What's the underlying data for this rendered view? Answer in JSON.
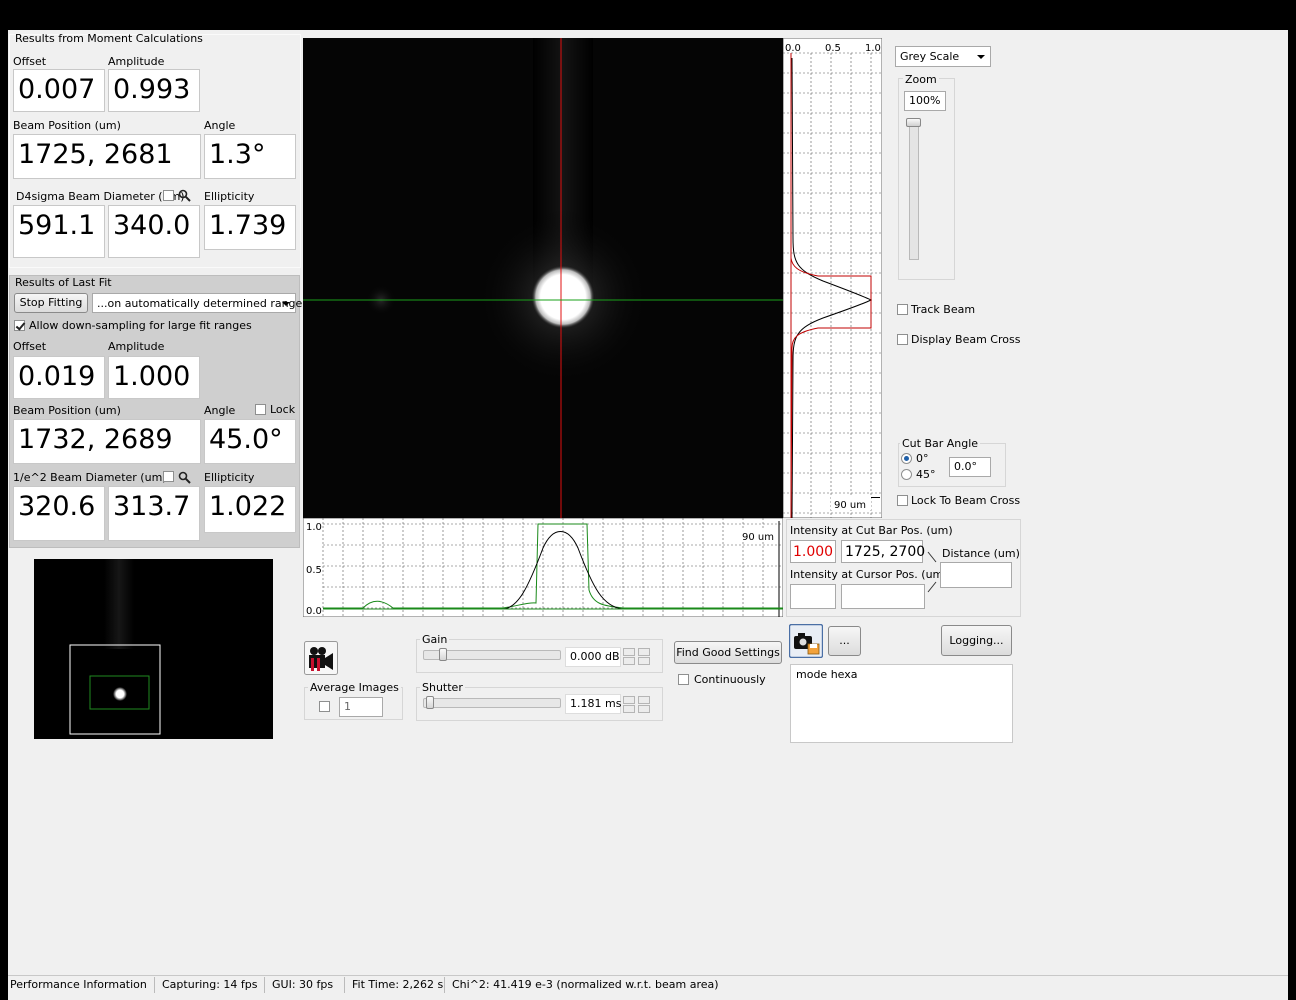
{
  "moment": {
    "title": "Results from Moment Calculations",
    "offset_label": "Offset",
    "offset": "0.007",
    "amplitude_label": "Amplitude",
    "amplitude": "0.993",
    "beam_pos_label": "Beam Position (um)",
    "beam_pos": "1725, 2681",
    "angle_label": "Angle",
    "angle": "1.3°",
    "diameter_label": "D4sigma Beam Diameter (um)",
    "diam_x": "591.1",
    "diam_y": "340.0",
    "ellipticity_label": "Ellipticity",
    "ellipticity": "1.739"
  },
  "fit": {
    "title": "Results of Last Fit",
    "stop_label": "Stop Fitting",
    "range_value": "...on automatically determined range",
    "downsample_label": "Allow down-sampling for large fit ranges",
    "offset_label": "Offset",
    "offset": "0.019",
    "amplitude_label": "Amplitude",
    "amplitude": "1.000",
    "beam_pos_label": "Beam Position (um)",
    "beam_pos": "1732, 2689",
    "angle_label": "Angle",
    "lock_label": "Lock",
    "angle": "45.0°",
    "diameter_label": "1/e^2 Beam Diameter (um)",
    "diam_x": "320.6",
    "diam_y": "313.7",
    "ellipticity_label": "Ellipticity",
    "ellipticity": "1.022"
  },
  "vprofile": {
    "tick_0": "0.0",
    "tick_05": "0.5",
    "tick_1": "1.0",
    "scale": "90 um"
  },
  "hprofile": {
    "tick_1": "1.0",
    "tick_05": "0.5",
    "tick_0": "0.0",
    "scale": "90 um"
  },
  "display": {
    "colormap": "Grey Scale",
    "zoom_label": "Zoom",
    "zoom_value": "100%",
    "zoom_level": 1.0,
    "track_beam": "Track Beam",
    "display_cross": "Display Beam Cross",
    "cut_angle_label": "Cut Bar Angle",
    "angle_0": "0°",
    "angle_45": "45°",
    "angle_value": "0.0°",
    "lock_cross": "Lock To Beam Cross"
  },
  "intensity": {
    "cut_label": "Intensity at Cut Bar Pos. (um)",
    "cut_value": "1.000",
    "cut_value_color": "#e00000",
    "cut_pos": "1725, 2700",
    "cursor_label": "Intensity at Cursor Pos. (um)",
    "distance_label": "Distance (um)"
  },
  "acquisition": {
    "gain_label": "Gain",
    "gain_value": "0.000 dB",
    "gain_level": 0.12,
    "shutter_label": "Shutter",
    "shutter_value": "1.181 ms",
    "shutter_level": 0.02,
    "find_settings": "Find Good Settings",
    "continuously": "Continuously",
    "avg_label": "Average Images",
    "avg_value": "1"
  },
  "logging": {
    "button": "Logging...",
    "more": "...",
    "text": "mode hexa"
  },
  "status": {
    "performance": "Performance Information",
    "capturing": "Capturing: 14 fps",
    "gui": "GUI: 30 fps",
    "fit_time": "Fit Time: 2,262 s",
    "chi": "Chi^2:  41.419 e-3  (normalized w.r.t. beam area)"
  },
  "icons": [
    "magnifier-icon",
    "record-icon",
    "camera-save-icon"
  ]
}
